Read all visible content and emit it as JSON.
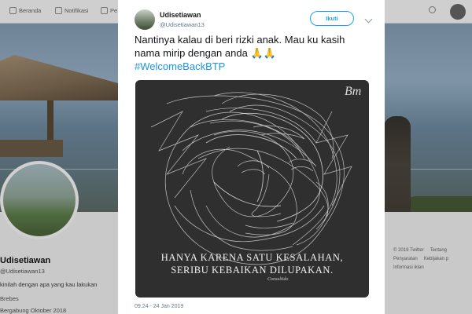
{
  "app": {
    "nav": {
      "home_label": "Beranda",
      "notifications_label": "Notifikasi",
      "messages_label": "Pe"
    },
    "profile": {
      "name": "Udisetiawan",
      "handle": "@Udisetiawan13",
      "bio": "kinilah dengan apa yang kau lakukan",
      "location": "Brebes",
      "joined": "Bergabung Oktober 2018"
    },
    "footer": {
      "items": [
        "© 2019 Twitter",
        "Tentang",
        "Penyaratan",
        "Kebijakan p",
        "Informasi iklan"
      ]
    }
  },
  "tweet": {
    "author_name": "Udisetiawan",
    "author_handle": "@Udisetiawan13",
    "follow_label": "Ikuti",
    "text": "Nantinya kalau di beri rizki anak. Mau ku kasih nama mirip dengan anda",
    "emoji": "🙏🙏",
    "hashtag": "#WelcomeBackBTP",
    "image": {
      "caption_line1": "HANYA KARENA SATU KESALAHAN,",
      "caption_line2": "SERIBU KEBAIKAN DILUPAKAN.",
      "signature": "Consultido",
      "watermark": "Bm"
    },
    "timestamp": "09.24 - 24 Jan 2019"
  },
  "colors": {
    "accent": "#1da1f2",
    "hashtag": "#1b95e0",
    "secondary_text": "#657786"
  }
}
